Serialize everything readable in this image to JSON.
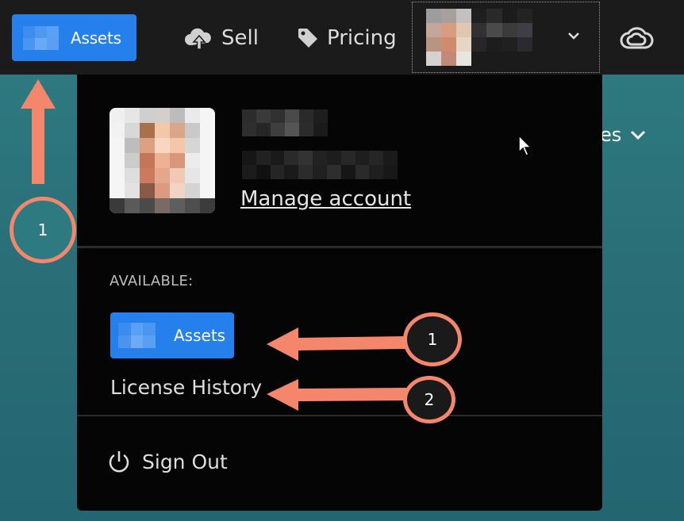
{
  "header": {
    "assets_label": "Assets",
    "sell_label": "Sell",
    "pricing_label": "Pricing",
    "upload_icon": "cloud-upload-icon",
    "tag_icon": "tag-icon",
    "creative_cloud_icon": "creative-cloud-icon"
  },
  "profile": {
    "manage_account_label": "Manage account"
  },
  "menu": {
    "section_label": "AVAILABLE:",
    "assets_label": "Assets",
    "license_history_label": "License History",
    "sign_out_label": "Sign Out"
  },
  "background": {
    "partial_text": "es"
  },
  "annotations": {
    "top_callout": "1",
    "assets_callout": "1",
    "license_callout": "2"
  },
  "colors": {
    "accent_blue": "#2680eb",
    "annotation_salmon": "#f4866b",
    "topbar": "#1b1b1b",
    "dropdown": "#050505"
  }
}
